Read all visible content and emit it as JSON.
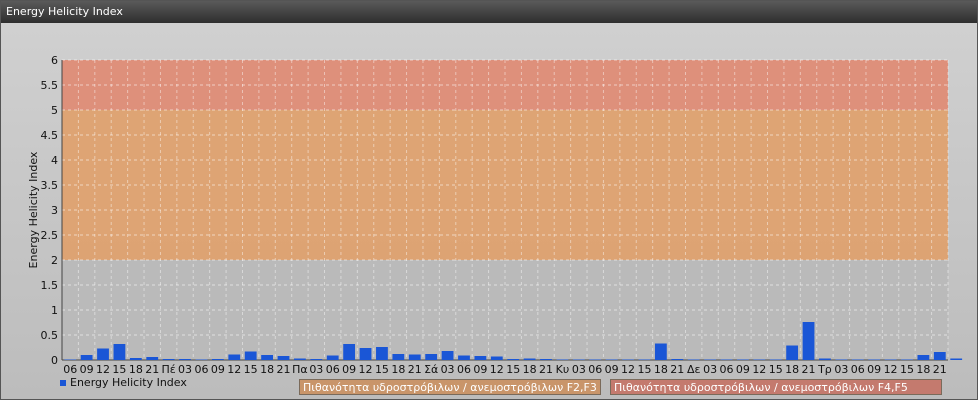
{
  "window": {
    "title": "Energy Helicity Index"
  },
  "colors": {
    "bar": "#1a56d6",
    "band_low": "#b9b9b9",
    "band_mid": "#e0a06a",
    "band_high": "#e08a72"
  },
  "legend": {
    "series_label": "Energy Helicity Index"
  },
  "bands": {
    "f2f3_label": "Πιθανότητα υδροστρόβιλων / ανεμοστρόβιλων F2,F3",
    "f4f5_label": "Πιθανότητα υδροστρόβιλων / ανεμοστρόβιλων F4,F5"
  },
  "chart_data": {
    "type": "bar",
    "ylabel": "Energy Helicity Index",
    "ylim": [
      0,
      6
    ],
    "yticks": [
      "0",
      "0.5",
      "1",
      "1.5",
      "2",
      "2.5",
      "3",
      "3.5",
      "4",
      "4.5",
      "5",
      "5.5",
      "6"
    ],
    "grid": true,
    "bands": [
      {
        "from": 0,
        "to": 2,
        "label": ""
      },
      {
        "from": 2,
        "to": 5,
        "label": "Πιθανότητα υδροστρόβιλων / ανεμοστρόβιλων F2,F3"
      },
      {
        "from": 5,
        "to": 6,
        "label": "Πιθανότητα υδροστρόβιλων / ανεμοστρόβιλων F4,F5"
      }
    ],
    "categories": [
      "06",
      "09",
      "12",
      "15",
      "18",
      "21",
      "Πέ",
      "03",
      "06",
      "09",
      "12",
      "15",
      "18",
      "21",
      "Πα",
      "03",
      "06",
      "09",
      "12",
      "15",
      "18",
      "21",
      "Σά",
      "03",
      "06",
      "09",
      "12",
      "15",
      "18",
      "21",
      "Κυ",
      "03",
      "06",
      "09",
      "12",
      "15",
      "18",
      "21",
      "Δε",
      "03",
      "06",
      "09",
      "12",
      "15",
      "18",
      "21",
      "Τρ",
      "03",
      "06",
      "09",
      "12",
      "15",
      "18",
      "21"
    ],
    "series": [
      {
        "name": "Energy Helicity Index",
        "values": [
          0.01,
          0.1,
          0.23,
          0.32,
          0.04,
          0.06,
          0.02,
          0.02,
          0.01,
          0.02,
          0.11,
          0.17,
          0.1,
          0.08,
          0.03,
          0.02,
          0.09,
          0.32,
          0.24,
          0.26,
          0.12,
          0.11,
          0.12,
          0.18,
          0.09,
          0.08,
          0.07,
          0.02,
          0.03,
          0.02,
          0.01,
          0.01,
          0.01,
          0.01,
          0.01,
          0.01,
          0.33,
          0.02,
          0.01,
          0.01,
          0.01,
          0.01,
          0.01,
          0.01,
          0.29,
          0.76,
          0.03,
          0.01,
          0.01,
          0.01,
          0.01,
          0.01,
          0.1,
          0.16,
          0.03
        ]
      }
    ],
    "legend_position": "bottom-left"
  }
}
